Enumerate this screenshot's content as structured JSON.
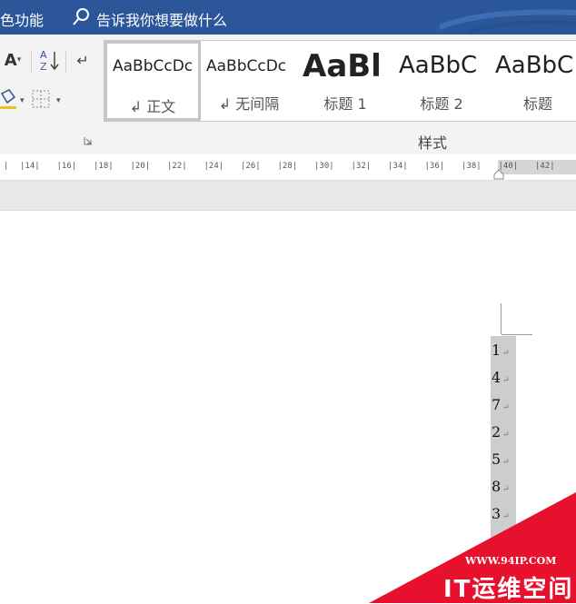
{
  "titlebar": {
    "left_fragment": "色功能",
    "tell_me": "告诉我你想要做什么"
  },
  "ribbon": {
    "tools": {
      "font_grow": "A",
      "sort": "A↓Z",
      "return": "↵"
    },
    "styles": [
      {
        "sample": "AaBbCcDc",
        "name": "↲ 正文",
        "selected": true
      },
      {
        "sample": "AaBbCcDc",
        "name": "↲ 无间隔",
        "selected": false
      },
      {
        "sample": "AaBl",
        "name": "标题 1",
        "selected": false
      },
      {
        "sample": "AaBbC",
        "name": "标题 2",
        "selected": false
      },
      {
        "sample": "AaBbC",
        "name": "标题",
        "selected": false
      }
    ],
    "group_label": "样式"
  },
  "ruler": {
    "ticks": [
      "14",
      "16",
      "18",
      "20",
      "22",
      "24",
      "26",
      "28",
      "30",
      "32",
      "34",
      "36",
      "38",
      "40",
      "42"
    ]
  },
  "document": {
    "lines": [
      "1",
      "4",
      "7",
      "2",
      "5",
      "8",
      "3"
    ]
  },
  "watermark": {
    "url": "WWW.94IP.COM",
    "name": "IT运维空间"
  },
  "colors": {
    "titlebar": "#2b579a",
    "ribbon": "#f3f3f3",
    "watermark": "#e8112d"
  }
}
